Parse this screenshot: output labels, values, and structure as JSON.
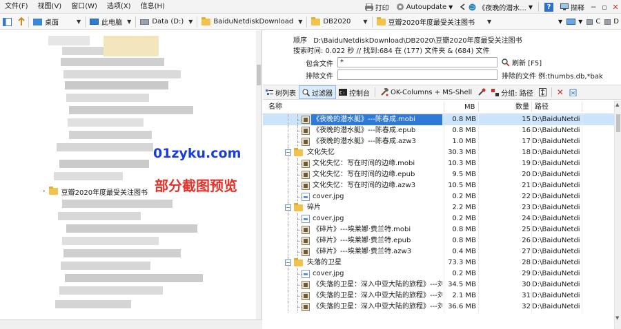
{
  "menubar": {
    "items": [
      "文件(F)",
      "视图(V)",
      "窗口(W)",
      "选项(X)",
      "信息(H)"
    ],
    "print": "打印",
    "autoupdate": "Autoupdate",
    "window_title": "《夜晚的潜水...",
    "help": "?",
    "capture": "撷释"
  },
  "addressbar": {
    "crumbs": [
      "桌面",
      "此电脑",
      "Data (D:)",
      "BaiduNetdiskDownload",
      "DB2020",
      "豆瓣2020年度最受关注图书"
    ],
    "right_labels": [
      "C",
      "D"
    ]
  },
  "left": {
    "tree_item": "豆瓣2020年度最受关注图书",
    "watermark_site": "01zyku.com",
    "watermark_note": "部分截图预览"
  },
  "info": {
    "order_label": "顺序",
    "order_path": "D:\\BaiduNetdiskDownload\\DB2020\\豆瓣2020年度最受关注图书",
    "search_time": "搜索时间: 0.022 秒 //  找到:684 在 (177) 文件夹 & (684) 文件"
  },
  "filter": {
    "include_label": "包含文件",
    "include_value": "*",
    "exclude_label": "排除文件",
    "exclude_value": "",
    "refresh": "刷新 [F5]",
    "exclude_text": "排除的文件 例:thumbs.db,*bak"
  },
  "toolbar": {
    "tree": "树列表",
    "filter": "过滤器",
    "console": "控制台",
    "columns": "OK-Columns + MS-Shell",
    "group": "分组: 路径"
  },
  "table": {
    "headers": {
      "name": "名称",
      "mb": "MB",
      "count": "数量",
      "path": "路径"
    },
    "rows": [
      {
        "type": "book",
        "level": 2,
        "name": "《夜晚的潜水艇》---陈春成.mobi",
        "mb": "0.8 MB",
        "count": "15",
        "path": "D:\\BaiduNetdi...",
        "selected": true
      },
      {
        "type": "book",
        "level": 2,
        "name": "《夜晚的潜水艇》---陈春成.epub",
        "mb": "0.8 MB",
        "count": "16",
        "path": "D:\\BaiduNetdi..."
      },
      {
        "type": "book",
        "level": 2,
        "name": "《夜晚的潜水艇》---陈春成.azw3",
        "mb": "1.0 MB",
        "count": "17",
        "path": "D:\\BaiduNetdi..."
      },
      {
        "type": "folder",
        "level": 1,
        "name": "文化失忆",
        "mb": "30.3 MB",
        "count": "18",
        "path": "D:\\BaiduNetdi..."
      },
      {
        "type": "book",
        "level": 2,
        "name": "文化失忆：写在时间的边缘.mobi",
        "mb": "10.3 MB",
        "count": "19",
        "path": "D:\\BaiduNetdi..."
      },
      {
        "type": "book",
        "level": 2,
        "name": "文化失忆：写在时间的边缘.epub",
        "mb": "9.5 MB",
        "count": "20",
        "path": "D:\\BaiduNetdi..."
      },
      {
        "type": "book",
        "level": 2,
        "name": "文化失忆：写在时间的边缘.azw3",
        "mb": "10.5 MB",
        "count": "21",
        "path": "D:\\BaiduNetdi..."
      },
      {
        "type": "image",
        "level": 2,
        "name": "cover.jpg",
        "mb": "0.2 MB",
        "count": "22",
        "path": "D:\\BaiduNetdi..."
      },
      {
        "type": "folder",
        "level": 1,
        "name": "碎片",
        "mb": "2.2 MB",
        "count": "23",
        "path": "D:\\BaiduNetdi..."
      },
      {
        "type": "image",
        "level": 2,
        "name": "cover.jpg",
        "mb": "0.2 MB",
        "count": "24",
        "path": "D:\\BaiduNetdi..."
      },
      {
        "type": "book",
        "level": 2,
        "name": "《碎片》---埃莱娜·费兰特.mobi",
        "mb": "0.8 MB",
        "count": "25",
        "path": "D:\\BaiduNetdi..."
      },
      {
        "type": "book",
        "level": 2,
        "name": "《碎片》---埃莱娜·费兰特.epub",
        "mb": "0.8 MB",
        "count": "26",
        "path": "D:\\BaiduNetdi..."
      },
      {
        "type": "book",
        "level": 2,
        "name": "《碎片》---埃莱娜·费兰特.azw3",
        "mb": "0.4 MB",
        "count": "27",
        "path": "D:\\BaiduNetdi..."
      },
      {
        "type": "folder",
        "level": 1,
        "name": "失落的卫星",
        "mb": "73.3 MB",
        "count": "28",
        "path": "D:\\BaiduNetdi..."
      },
      {
        "type": "image",
        "level": 2,
        "name": "cover.jpg",
        "mb": "0.2 MB",
        "count": "29",
        "path": "D:\\BaiduNetdi..."
      },
      {
        "type": "book",
        "level": 2,
        "name": "《失落的卫星：深入中亚大陆的旅程》---刘...",
        "mb": "34.5 MB",
        "count": "30",
        "path": "D:\\BaiduNetdi..."
      },
      {
        "type": "book",
        "level": 2,
        "name": "《失落的卫星：深入中亚大陆的旅程》---刘...",
        "mb": "2.1 MB",
        "count": "31",
        "path": "D:\\BaiduNetdi..."
      },
      {
        "type": "book",
        "level": 2,
        "name": "《失落的卫星：深入中亚大陆的旅程》---刘...",
        "mb": "36.6 MB",
        "count": "32",
        "path": "D:\\BaiduNetdi..."
      }
    ]
  },
  "colors": {
    "accent": "#2f7ad6",
    "selected_row": "#cce4fb",
    "folder": "#f1c24c",
    "watermark_blue": "#1a3fd8",
    "watermark_red": "#e4332a"
  }
}
